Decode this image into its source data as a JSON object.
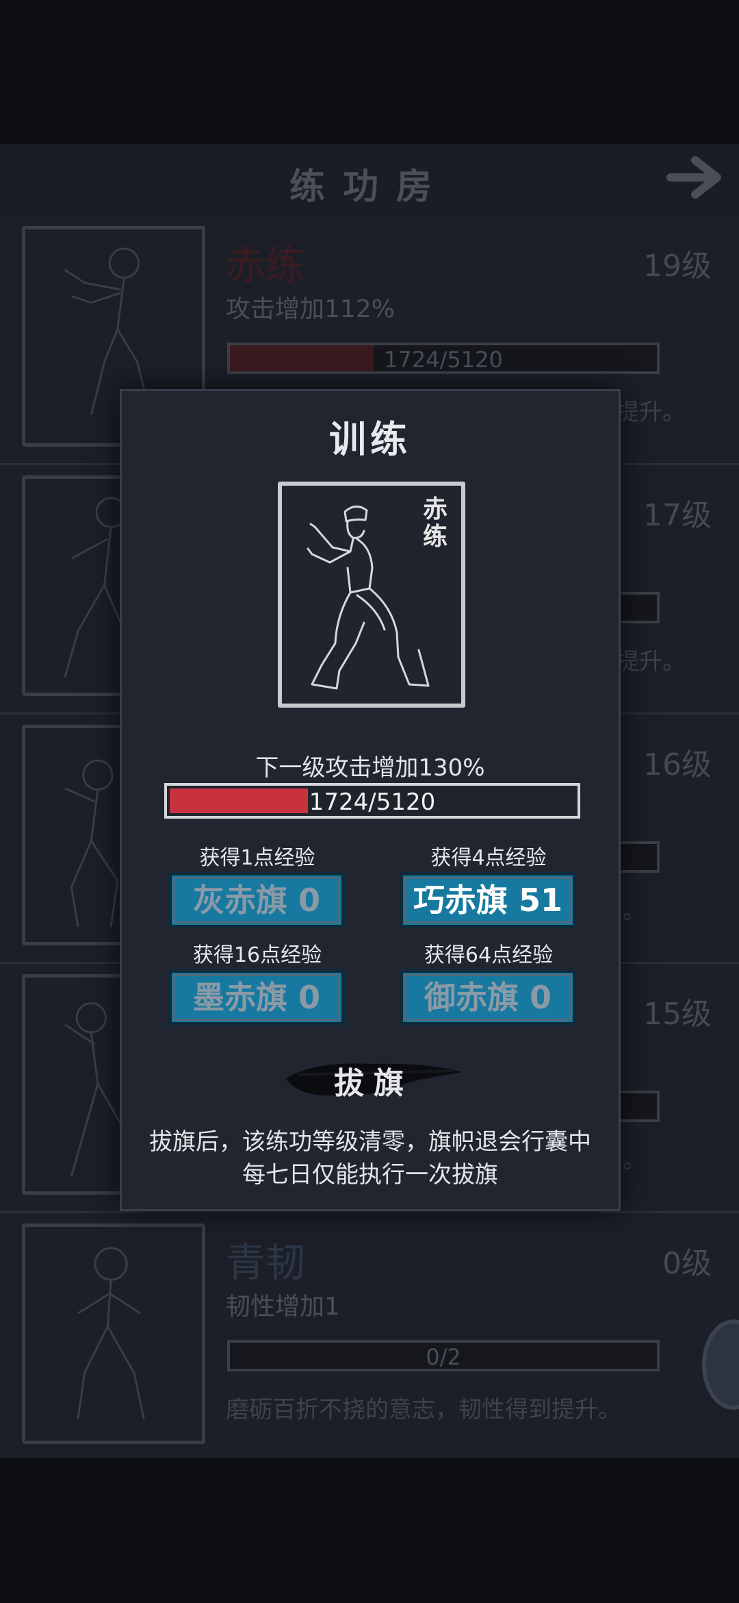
{
  "header": {
    "title": "练功房"
  },
  "skills": [
    {
      "name": "赤练",
      "level": "19级",
      "effect": "攻击增加112%",
      "progress_text": "1724/5120",
      "progress_fraction": 0.337,
      "desc": "提升。"
    },
    {
      "name": "",
      "level": "17级",
      "effect": "",
      "progress_text": "",
      "progress_fraction": 0,
      "desc": "提升。"
    },
    {
      "name": "",
      "level": "16级",
      "effect": "",
      "progress_text": "",
      "progress_fraction": 0,
      "desc": "。"
    },
    {
      "name": "",
      "level": "15级",
      "effect": "",
      "progress_text": "",
      "progress_fraction": 0.05,
      "desc": "。"
    },
    {
      "name": "青韧",
      "level": "0级",
      "effect": "韧性增加1",
      "progress_text": "0/2",
      "progress_fraction": 0,
      "desc": "磨砺百折不挠的意志，韧性得到提升。"
    }
  ],
  "modal": {
    "title": "训练",
    "card_name": "赤练",
    "next_level_text": "下一级攻击增加130%",
    "exp_text": "1724/5120",
    "exp_fraction": 0.337,
    "flags": [
      {
        "label": "获得1点经验",
        "button": "灰赤旗 0"
      },
      {
        "label": "获得4点经验",
        "button": "巧赤旗 51"
      },
      {
        "label": "获得16点经验",
        "button": "墨赤旗 0"
      },
      {
        "label": "获得64点经验",
        "button": "御赤旗 0"
      }
    ],
    "pull_flag_label": "拔旗",
    "notes": [
      "拔旗后，该练功等级清零，旗帜退会行囊中",
      "每七日仅能执行一次拔旗"
    ]
  },
  "colors": {
    "accent_red": "#c8323e",
    "button_blue": "#17799f"
  }
}
